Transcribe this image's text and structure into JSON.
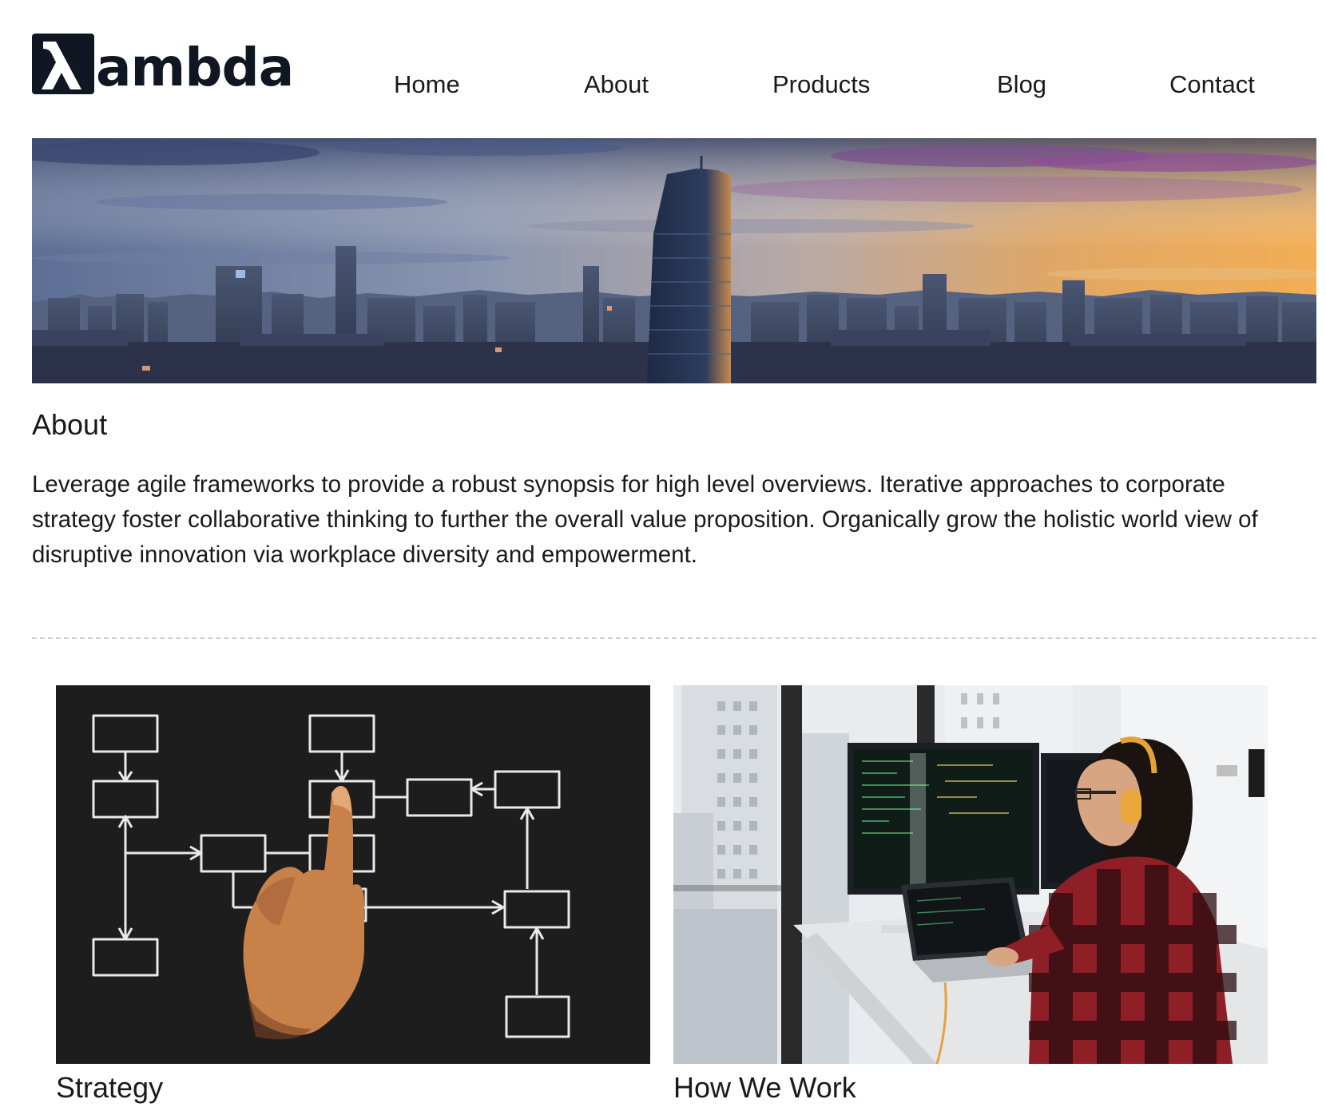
{
  "header": {
    "logo_text": "ambda",
    "logo_mark": "lambda-icon",
    "nav": [
      "Home",
      "About",
      "Products",
      "Blog",
      "Contact"
    ]
  },
  "hero": {
    "image": "city-skyline-sunset-image"
  },
  "about": {
    "title": "About",
    "text": "Leverage agile frameworks to provide a robust synopsis for high level overviews. Iterative approaches to corporate strategy foster collaborative thinking to further the overall value proposition. Organically grow the holistic world view of disruptive innovation via workplace diversity and empowerment."
  },
  "cards": [
    {
      "title": "Strategy",
      "image": "flowchart-chalkboard-image"
    },
    {
      "title": "How We Work",
      "image": "developer-at-desk-image"
    }
  ],
  "colors": {
    "logo": "#111722",
    "text": "#1a1a1a",
    "divider": "#cfcfcf"
  }
}
